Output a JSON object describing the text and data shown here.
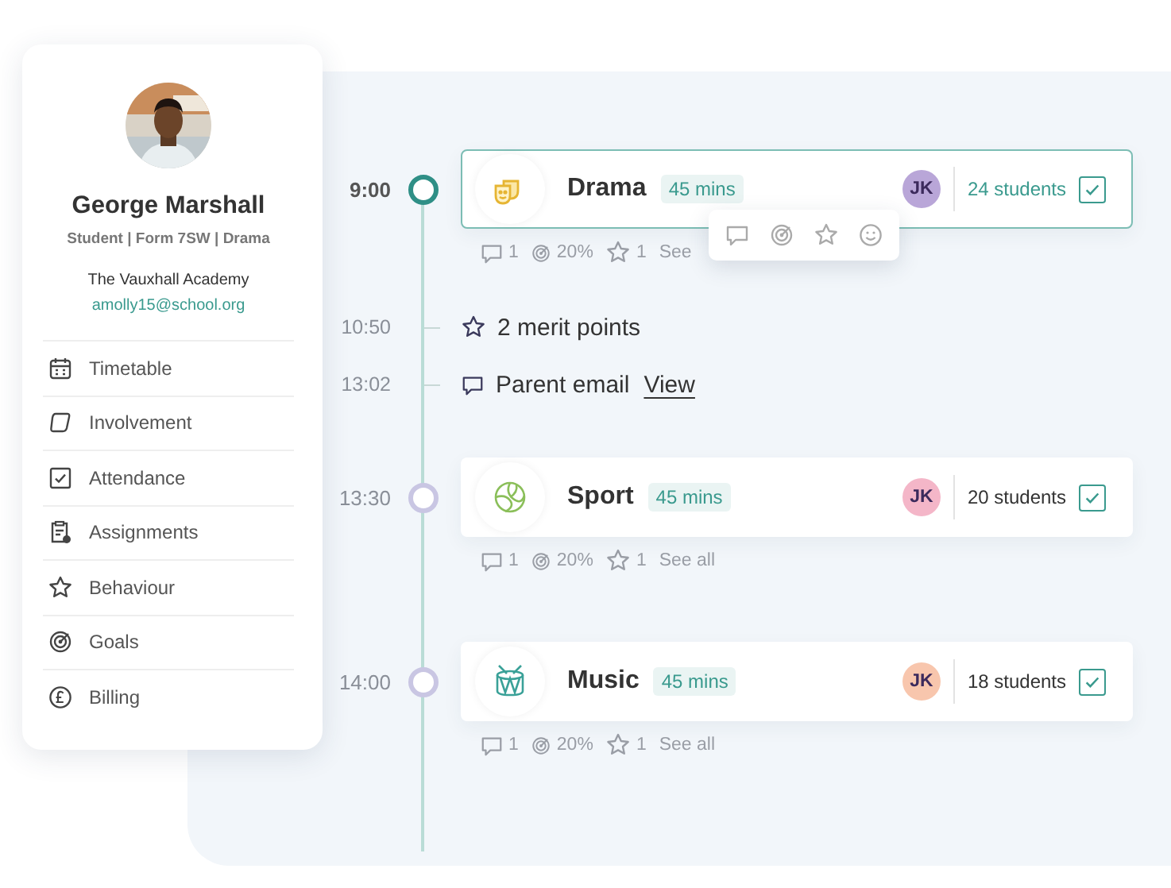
{
  "profile": {
    "name": "George Marshall",
    "role": "Student | Form 7SW | Drama",
    "school": "The Vauxhall Academy",
    "email": "amolly15@school.org",
    "nav": [
      {
        "label": "Timetable"
      },
      {
        "label": "Involvement"
      },
      {
        "label": "Attendance"
      },
      {
        "label": "Assignments"
      },
      {
        "label": "Behaviour"
      },
      {
        "label": "Goals"
      },
      {
        "label": "Billing"
      }
    ]
  },
  "timeline": [
    {
      "kind": "lesson",
      "time": "9:00",
      "subject": "Drama",
      "duration": "45 mins",
      "teacher": "JK",
      "color": "#b9a6d8",
      "students": "24 students",
      "checked": true,
      "selected": true,
      "comments": "1",
      "goals": "20%",
      "stars": "1",
      "see_all": "See",
      "menu": true
    },
    {
      "kind": "merit",
      "time": "10:50",
      "text": "2 merit points"
    },
    {
      "kind": "email",
      "time": "13:02",
      "text": "Parent email",
      "link": "View"
    },
    {
      "kind": "lesson",
      "time": "13:30",
      "subject": "Sport",
      "duration": "45 mins",
      "teacher": "JK",
      "color": "#f4b6c8",
      "students": "20 students",
      "checked": true,
      "selected": false,
      "comments": "1",
      "goals": "20%",
      "stars": "1",
      "see_all": "See all",
      "menu": false
    },
    {
      "kind": "lesson",
      "time": "14:00",
      "subject": "Music",
      "duration": "45 mins",
      "teacher": "JK",
      "color": "#f8c6ad",
      "students": "18 students",
      "checked": true,
      "selected": false,
      "comments": "1",
      "goals": "20%",
      "stars": "1",
      "see_all": "See all",
      "menu": false
    }
  ]
}
